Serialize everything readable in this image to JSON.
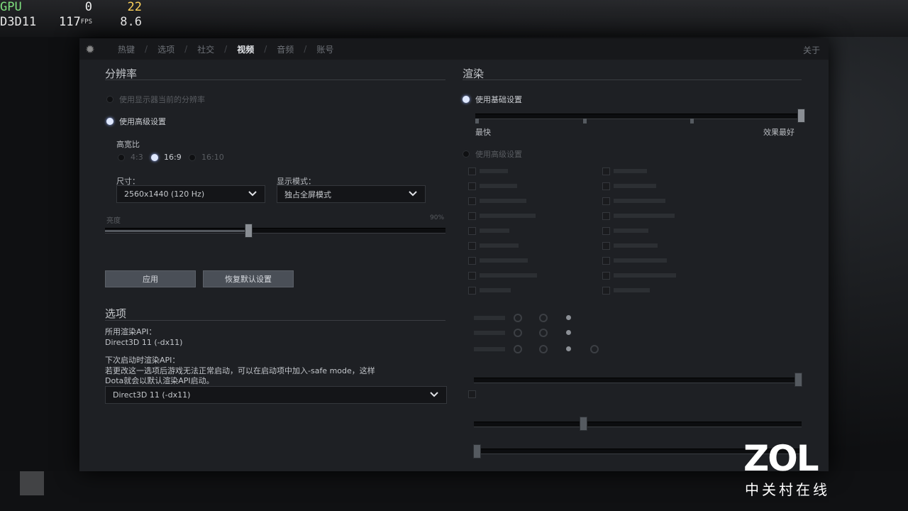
{
  "overlay": {
    "gpu_label": "GPU",
    "gpu_value": "0",
    "gpu_temp": "22",
    "api_label": "D3D11",
    "fps_value": "117",
    "fps_unit": "FPS",
    "frametime": "8.6"
  },
  "panel": {
    "tabs": [
      "热键",
      "选项",
      "社交",
      "视频",
      "音频",
      "账号"
    ],
    "active_tab": "视频",
    "about_label": "关于"
  },
  "resolution": {
    "title": "分辨率",
    "use_display_label": "使用显示器当前的分辨率",
    "use_advanced_label": "使用高级设置",
    "aspect_label": "高宽比",
    "aspect_options": [
      "4:3",
      "16:9",
      "16:10"
    ],
    "aspect_selected": "16:9",
    "size_label": "尺寸：",
    "size_value": "2560x1440 (120 Hz)",
    "display_mode_label": "显示模式：",
    "display_mode_value": "独占全屏模式",
    "brightness_label": "亮度",
    "brightness_value": "90%",
    "brightness_level": 0.42,
    "apply_label": "应用",
    "restore_label": "恢复默认设置"
  },
  "options": {
    "title": "选项",
    "api_label": "所用渲染API：",
    "api_value": "Direct3D 11 (-dx11)",
    "next_api_label": "下次启动时渲染API：",
    "next_api_note_1": "若更改这一选项后游戏无法正常启动，可以在启动项中加入-safe mode，这样",
    "next_api_note_2": "Dota就会以默认渲染API启动。",
    "next_api_value": "Direct3D 11 (-dx11)"
  },
  "render": {
    "title": "渲染",
    "use_basic_label": "使用基础设置",
    "fastest_label": "最快",
    "best_label": "效果最好",
    "quality_level": 1.0,
    "use_advanced_label": "使用高级设置"
  },
  "watermark": {
    "brand": "ZOL",
    "brand_sub": "中关村在线"
  },
  "colors": {
    "panel_bg": "#1e2024",
    "accent_radio": "#dfe8ff",
    "overlay_gpu": "#7fe07f",
    "overlay_temp": "#ffd35c"
  }
}
